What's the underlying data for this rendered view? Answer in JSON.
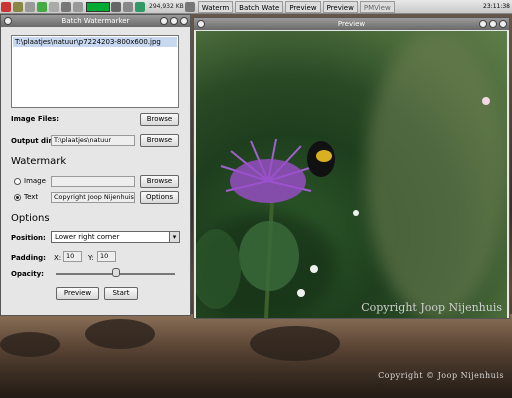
{
  "taskbar": {
    "memory": "294,932 KB",
    "tasks": [
      "Waterm",
      "Batch Wate",
      "Preview",
      "Preview",
      "PMView"
    ],
    "clock": "23:11:38"
  },
  "batch_window": {
    "title": "Batch Watermarker",
    "file_list": [
      "T:\\plaatjes\\natuur\\p7224203-800x600.jpg"
    ],
    "image_files_label": "Image Files:",
    "browse_label": "Browse",
    "output_dir_label": "Output dir:",
    "output_dir_value": "T:\\plaatjes\\natuur",
    "watermark_heading": "Watermark",
    "image_radio_label": "Image",
    "image_value": "",
    "text_radio_label": "Text",
    "text_value": "Copyright Joop Nijenhuis",
    "options_button": "Options",
    "options_heading": "Options",
    "position_label": "Position:",
    "position_value": "Lower right corner",
    "padding_label": "Padding:",
    "padding_x_label": "X:",
    "padding_x": "10",
    "padding_y_label": "Y:",
    "padding_y": "10",
    "opacity_label": "Opacity:",
    "opacity_fraction": 0.5,
    "preview_button": "Preview",
    "start_button": "Start"
  },
  "preview_window": {
    "title": "Preview",
    "watermark_overlay": "Copyright Joop Nijenhuis"
  },
  "desktop": {
    "watermark_text": "Copyright © Joop Nijenhuis"
  }
}
